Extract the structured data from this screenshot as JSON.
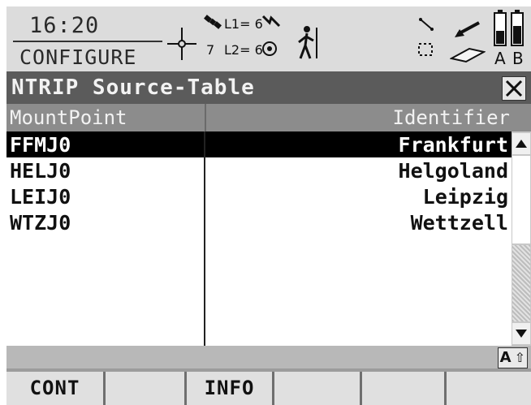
{
  "status": {
    "time": "16:20",
    "mode": "CONFIGURE",
    "sat_count": "7",
    "l1_label": "L1= 6",
    "l2_label": "L2= 6",
    "icons": [
      "crosshair-icon",
      "satellite-icon",
      "signal-bolt-icon",
      "target-icon",
      "walking-person-icon",
      "line-icon",
      "points-icon",
      "arrow-icon",
      "eraser-icon",
      "battery-a-icon",
      "battery-b-icon"
    ],
    "battery_a_label": "A",
    "battery_b_label": "B"
  },
  "titlebar": {
    "title": "NTRIP Source-Table",
    "close_icon": "close-icon"
  },
  "table": {
    "columns": [
      "MountPoint",
      "Identifier"
    ],
    "rows": [
      {
        "mountpoint": "FFMJ0",
        "identifier": "Frankfurt",
        "selected": true
      },
      {
        "mountpoint": "HELJ0",
        "identifier": "Helgoland",
        "selected": false
      },
      {
        "mountpoint": "LEIJ0",
        "identifier": "Leipzig",
        "selected": false
      },
      {
        "mountpoint": "WTZJ0",
        "identifier": "Wettzell",
        "selected": false
      }
    ]
  },
  "input_mode": {
    "label": "A",
    "icon": "shift-arrow-icon",
    "glyph": "⇧"
  },
  "softkeys": [
    {
      "label": "CONT"
    },
    {
      "label": ""
    },
    {
      "label": "INFO"
    },
    {
      "label": ""
    },
    {
      "label": ""
    },
    {
      "label": ""
    }
  ],
  "colors": {
    "selection_background": "#000000",
    "titlebar_background": "#5b5b5b",
    "header_background": "#8c8c8c"
  }
}
